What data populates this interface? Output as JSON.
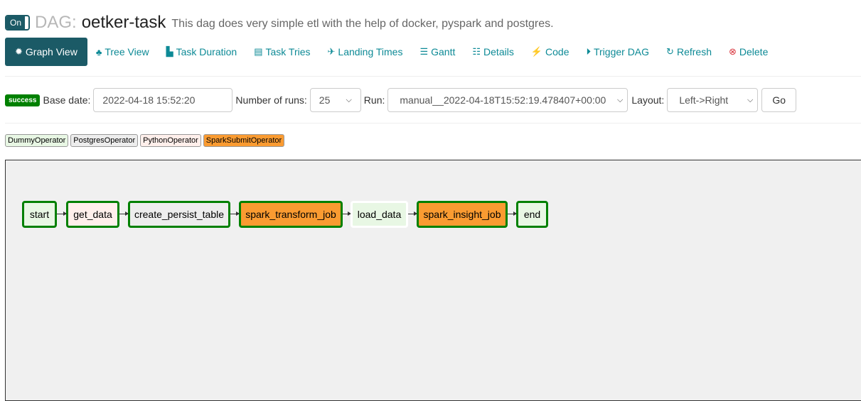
{
  "header": {
    "toggle_label": "On",
    "dag_label": "DAG:",
    "dag_id": "oetker-task",
    "description": "This dag does very simple etl with the help of docker, pyspark and postgres."
  },
  "nav": [
    {
      "label": "Graph View",
      "icon": "sun-icon",
      "active": true
    },
    {
      "label": "Tree View",
      "icon": "tree-icon"
    },
    {
      "label": "Task Duration",
      "icon": "bar-chart-icon"
    },
    {
      "label": "Task Tries",
      "icon": "files-icon"
    },
    {
      "label": "Landing Times",
      "icon": "plane-icon"
    },
    {
      "label": "Gantt",
      "icon": "gantt-icon"
    },
    {
      "label": "Details",
      "icon": "list-icon"
    },
    {
      "label": "Code",
      "icon": "bolt-icon"
    },
    {
      "label": "Trigger DAG",
      "icon": "play-circle-icon"
    },
    {
      "label": "Refresh",
      "icon": "refresh-icon"
    },
    {
      "label": "Delete",
      "icon": "delete-circle-icon"
    }
  ],
  "controls": {
    "status": "success",
    "base_date_label": "Base date:",
    "base_date_value": "2022-04-18 15:52:20",
    "num_runs_label": "Number of runs:",
    "num_runs_value": "25",
    "run_label": "Run:",
    "run_value": "manual__2022-04-18T15:52:19.478407+00:00",
    "layout_label": "Layout:",
    "layout_value": "Left->Right",
    "go_label": "Go"
  },
  "operators": [
    {
      "name": "DummyOperator",
      "color": "#e8f7e4"
    },
    {
      "name": "PostgresOperator",
      "color": "#ededed"
    },
    {
      "name": "PythonOperator",
      "color": "#ffefeb"
    },
    {
      "name": "SparkSubmitOperator",
      "color": "#fa9b31"
    }
  ],
  "graph": {
    "tasks": [
      {
        "name": "start",
        "operator": "DummyOperator",
        "state": "success"
      },
      {
        "name": "get_data",
        "operator": "PythonOperator",
        "state": "success"
      },
      {
        "name": "create_persist_table",
        "operator": "PostgresOperator",
        "state": "success"
      },
      {
        "name": "spark_transform_job",
        "operator": "SparkSubmitOperator",
        "state": "success"
      },
      {
        "name": "load_data",
        "operator": "DummyOperator",
        "state": "none"
      },
      {
        "name": "spark_insight_job",
        "operator": "SparkSubmitOperator",
        "state": "success"
      },
      {
        "name": "end",
        "operator": "DummyOperator",
        "state": "success"
      }
    ],
    "colors": {
      "success_border": "#008000",
      "none_border": "#ffffff",
      "canvas_bg": "#f0f0f0"
    }
  }
}
